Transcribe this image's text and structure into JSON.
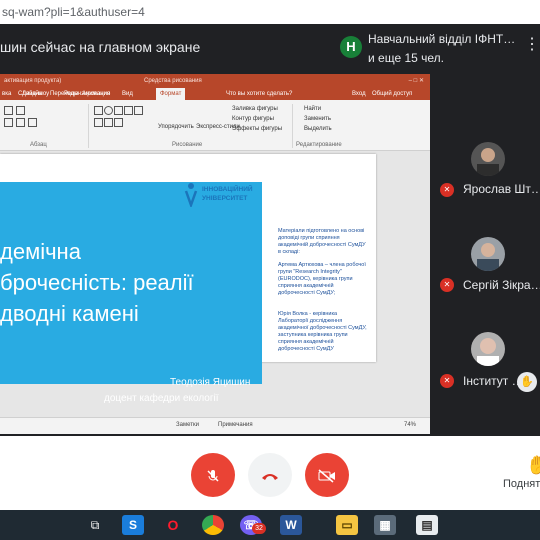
{
  "browser": {
    "url": "sq-wam?pli=1&authuser=4"
  },
  "meet": {
    "presenting_title": "шин сейчас на главном экране",
    "notification": {
      "avatar_letter": "Н",
      "line1": "Навчальний відділ ІФНТ…",
      "line2": "и еще 15 чел."
    },
    "more_label": "⋮"
  },
  "ppt": {
    "titlebar": {
      "left": "активация продукта)",
      "center": "Средства рисования",
      "window_controls": "–  □  ✕"
    },
    "tabs": [
      {
        "label": "вка"
      },
      {
        "label": "Дизайн"
      },
      {
        "label": "Переходы"
      },
      {
        "label": "Анимация"
      },
      {
        "label": "Слайд-шоу"
      },
      {
        "label": "Рецензирование"
      },
      {
        "label": "Вид"
      },
      {
        "label": "Формат"
      },
      {
        "label": "Что вы хотите сделать?"
      },
      {
        "label": "Вход"
      },
      {
        "label": "Общий доступ"
      }
    ],
    "ribbon": {
      "arrange": "Упорядочить",
      "express_styles": "Экспресс-стили",
      "fill": "Заливка фигуры",
      "outline": "Контур фигуры",
      "effects": "Эффекты фигуры",
      "find": "Найти",
      "replace": "Заменить",
      "select": "Выделить",
      "group_paragraph": "Абзац",
      "group_drawing": "Рисование",
      "group_editing": "Редактирование"
    },
    "slide": {
      "title_lines": [
        "демічна",
        "брочесність: реалії",
        "дводні камені"
      ],
      "author_name": "Теодозія Яцишин",
      "author_position": "доцент кафедри екології",
      "logo_line1": "ІННОВАЦІЙНИЙ",
      "logo_line2": "УНІВЕРСИТЕТ",
      "notes": [
        "Матеріали підготовлено на основі доповіді групи сприяння академічній доброчесності СумДУ в складі:",
        "Артема Артюхова – члена робочої групи \"Research Integrity\" (EURODOC), керівника групи сприяння академічній доброчесності СумДУ;",
        "Юрія Волка - керівника Лабораторії дослідження академічної доброчесності СумДУ, заступника керівника групи сприяння академічній доброчесності СумДУ"
      ]
    },
    "statusbar": {
      "notes": "Заметки",
      "comments": "Примечания",
      "zoom": "74%"
    }
  },
  "participants": [
    {
      "name": "Ярослав Шт…"
    },
    {
      "name": "Сергій Зікра…"
    },
    {
      "name": "Інститут …"
    }
  ],
  "controls": {
    "raise_hand_label": "Поднят"
  },
  "taskbar": {
    "chat_badge": "32"
  },
  "colors": {
    "ppt_accent": "#b7472a",
    "slide_blue": "#29abe2",
    "meet_red": "#ea4335",
    "dark_bg": "#202124"
  }
}
